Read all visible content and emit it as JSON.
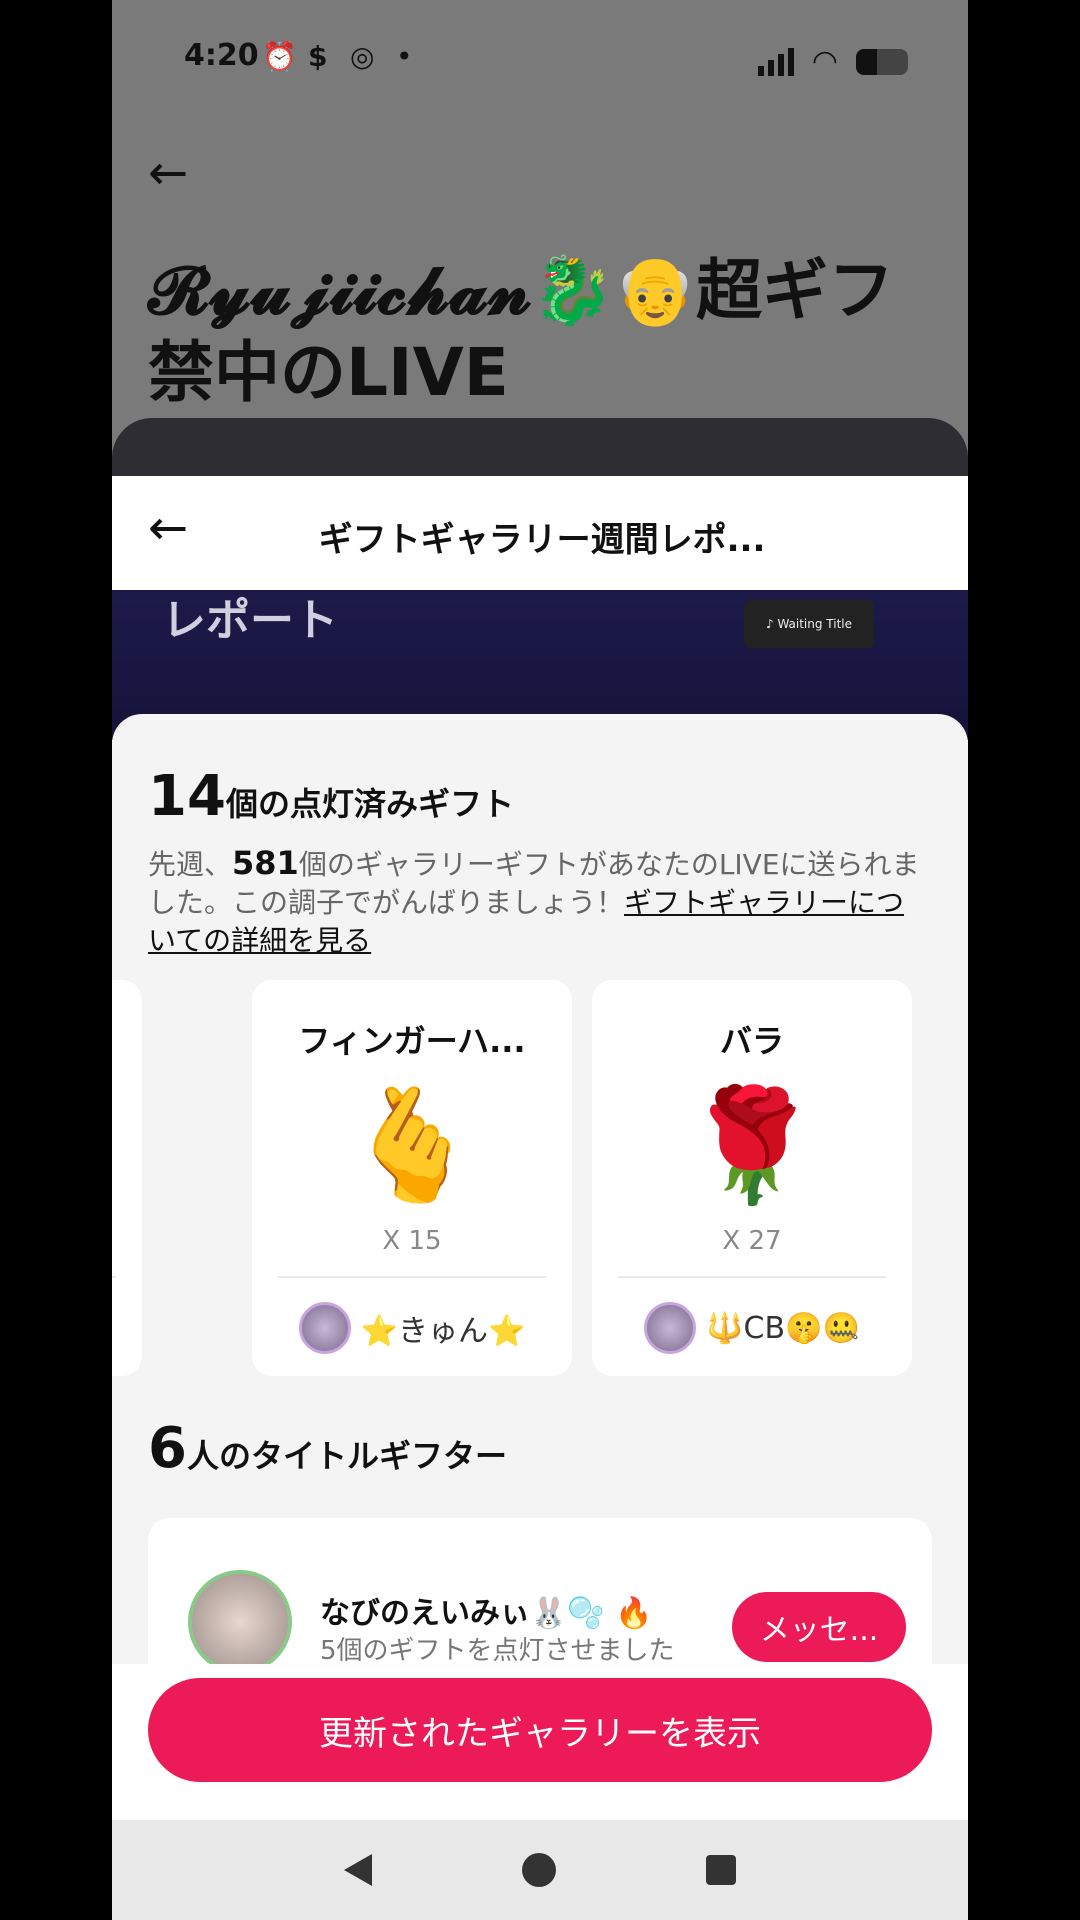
{
  "status_bar": {
    "time": "4:20",
    "icons": [
      "alarm-icon",
      "dollar-icon",
      "instagram-icon",
      "dot-icon",
      "signal-icon",
      "wifi-icon",
      "battery-icon"
    ]
  },
  "background": {
    "title": "𝓡𝔂𝓾𝓳𝓲𝓲𝓬𝓱𝓪𝓷🐉👴超ギフ禁中のLIVE"
  },
  "sheet": {
    "title": "ギフトギャラリー週間レポ...",
    "banner_text": "レポート",
    "banner_badge": "♪ Waiting Title"
  },
  "lit_gifts": {
    "count": "14",
    "heading_suffix": "個の点灯済みギフト",
    "desc_prefix": "先週、",
    "desc_count": "581",
    "desc_middle": "個のギャラリーギフトがあなたのLIVEに送られました。この調子でがんばりましょう！",
    "desc_link": "ギフトギャラリーについての詳細を見る"
  },
  "gifts": [
    {
      "name": "フィンガーハ...",
      "emoji": "🫰",
      "count": "X 15",
      "sender": "⭐きゅん⭐"
    },
    {
      "name": "バラ",
      "emoji": "🌹",
      "count": "X 27",
      "sender": "🔱CB🤫🤐"
    }
  ],
  "gifters": {
    "count": "6",
    "heading_suffix": "人のタイトルギフター",
    "first": {
      "name": "なびのえいみぃ🐰🫧 🔥",
      "subtitle": "5個のギフトを点灯させました",
      "button": "メッセ..."
    }
  },
  "footer": {
    "button": "更新されたギャラリーを表示"
  }
}
